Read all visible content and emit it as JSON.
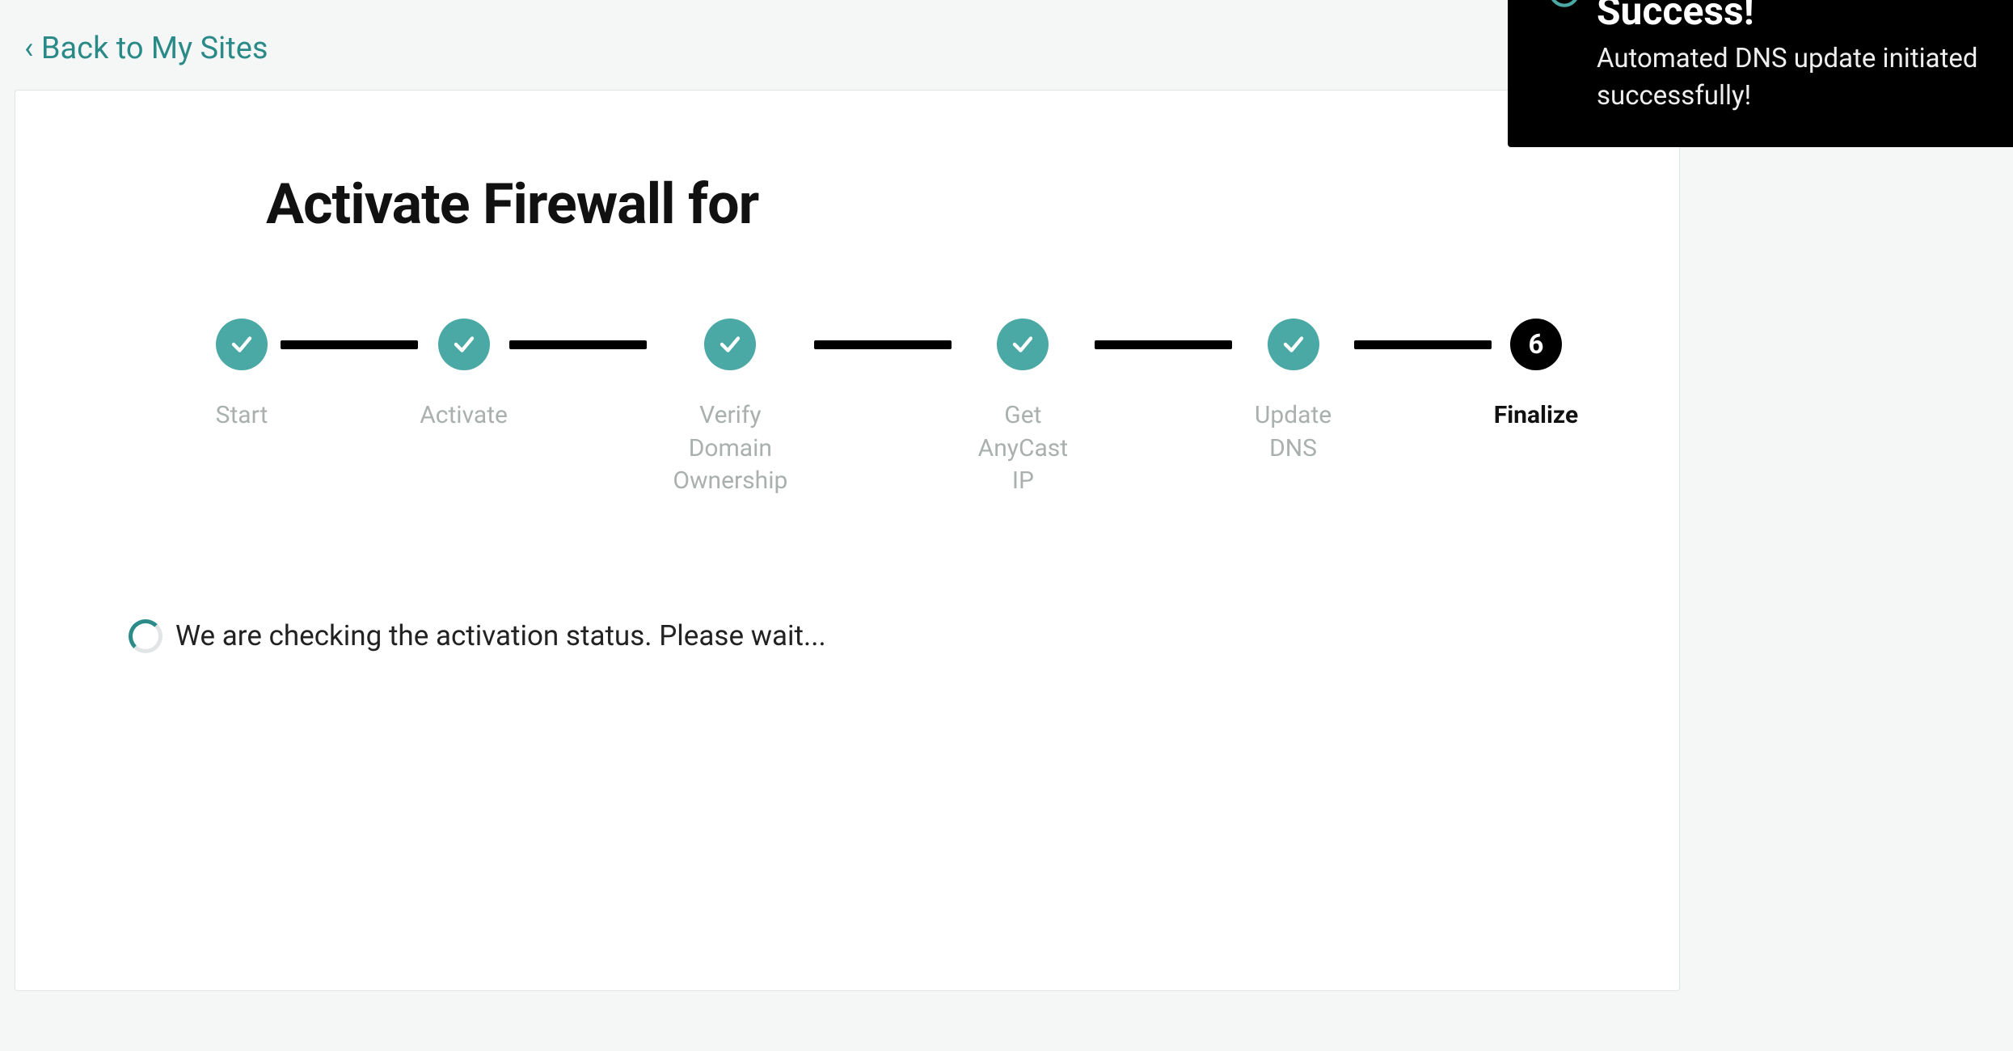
{
  "nav": {
    "back_link": "‹ Back to My Sites"
  },
  "header": {
    "title": "Activate Firewall for"
  },
  "stepper": {
    "steps": [
      {
        "label": "Start",
        "state": "done"
      },
      {
        "label": "Activate",
        "state": "done"
      },
      {
        "label": "Verify Domain Ownership",
        "state": "done"
      },
      {
        "label": "Get AnyCast IP",
        "state": "done"
      },
      {
        "label": "Update DNS",
        "state": "done"
      },
      {
        "label": "Finalize",
        "state": "current",
        "number": "6"
      }
    ]
  },
  "status": {
    "message": "We are checking the activation status. Please wait..."
  },
  "toast": {
    "title": "Success!",
    "message": "Automated DNS update initiated successfully!"
  }
}
